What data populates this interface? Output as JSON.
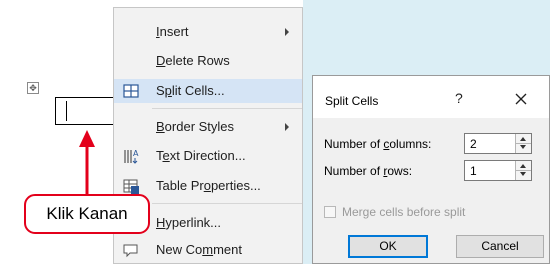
{
  "context_menu": {
    "items": [
      {
        "label": "Insert",
        "mnemonic_index": 0,
        "submenu": true
      },
      {
        "label": "Delete Rows",
        "mnemonic_index": 0
      },
      {
        "label": "Split Cells...",
        "mnemonic_index": 1,
        "highlighted": true,
        "icon": "split-cells-icon"
      },
      {
        "label": "Border Styles",
        "mnemonic_index": 0,
        "submenu": true
      },
      {
        "label": "Text Direction...",
        "mnemonic_index": 1,
        "icon": "text-direction-icon"
      },
      {
        "label": "Table Properties...",
        "mnemonic_index": 8,
        "icon": "table-properties-icon"
      },
      {
        "label": "Hyperlink...",
        "mnemonic_index": 0,
        "icon": "hyperlink-icon"
      },
      {
        "label": "New Comment",
        "mnemonic_index": 6,
        "icon": "comment-icon"
      }
    ]
  },
  "annotation": {
    "label": "Klik Kanan"
  },
  "table_handle_icon": "table-move-handle-icon",
  "dialog": {
    "title": "Split Cells",
    "help": "?",
    "close_icon": "close-icon",
    "columns_label": "Number of columns:",
    "columns_mnemonic_index": 10,
    "columns_value": "2",
    "rows_label": "Number of rows:",
    "rows_mnemonic_index": 10,
    "rows_value": "1",
    "merge_label": "Merge cells before split",
    "merge_checked": false,
    "merge_enabled": false,
    "ok_label": "OK",
    "cancel_label": "Cancel"
  },
  "colors": {
    "menu_highlight": "#d5e4f5",
    "annotation_red": "#e3001b",
    "side_panel": "#dbeef5",
    "default_button_border": "#0078d7"
  }
}
